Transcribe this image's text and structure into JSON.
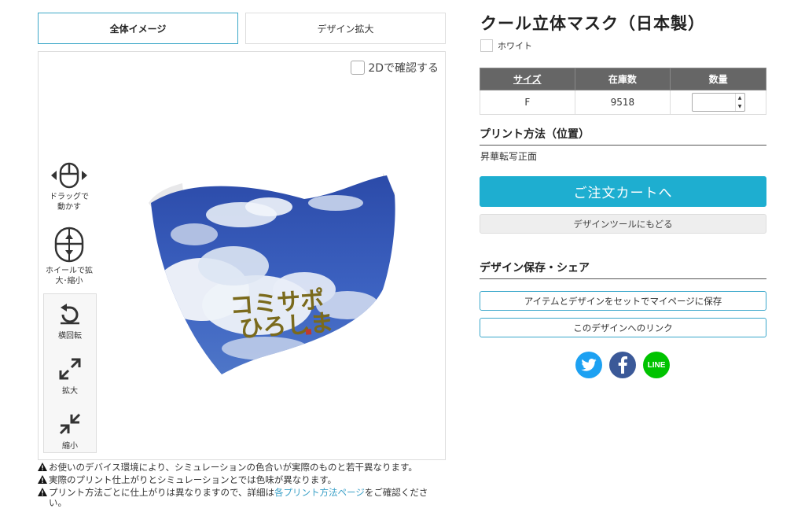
{
  "tabs": [
    {
      "label": "全体イメージ",
      "active": true
    },
    {
      "label": "デザイン拡大",
      "active": false
    }
  ],
  "viewer": {
    "toggle_2d_label": "2Dで確認する",
    "hints": {
      "drag": "ドラッグで動かす",
      "wheel": "ホイールで拡大･縮小"
    },
    "controls": {
      "rotate": "横回転",
      "zoom_in": "拡大",
      "zoom_out": "縮小"
    },
    "product_text": [
      "コミサポ",
      "ひろしま"
    ]
  },
  "notes": {
    "note1": "お使いのデバイス環境により、シミュレーションの色合いが実際のものと若干異なります。",
    "note2": "実際のプリント仕上がりとシミュレーションとでは色味が異なります。",
    "note3_pre": "プリント方法ごとに仕上がりは異なりますので、詳細は",
    "note3_link": "各プリント方法ページ",
    "note3_post": "をご確認ください。"
  },
  "product": {
    "title": "クール立体マスク（日本製）",
    "color_name": "ホワイト"
  },
  "stock_table": {
    "headers": {
      "size": "サイズ",
      "stock": "在庫数",
      "qty": "数量"
    },
    "rows": [
      {
        "size": "F",
        "stock": "9518",
        "qty": ""
      }
    ]
  },
  "print_method": {
    "heading": "プリント方法（位置）",
    "value": "昇華転写正面"
  },
  "buttons": {
    "cart": "ご注文カートへ",
    "back_to_tool": "デザインツールにもどる",
    "save_to_mypage": "アイテムとデザインをセットでマイページに保存",
    "design_link": "このデザインへのリンク"
  },
  "share": {
    "heading": "デザイン保存・シェア",
    "line_label": "LINE"
  },
  "colors": {
    "accent": "#1eaed0",
    "twitter": "#1da1f2",
    "facebook": "#3b5998",
    "line": "#00c300"
  }
}
